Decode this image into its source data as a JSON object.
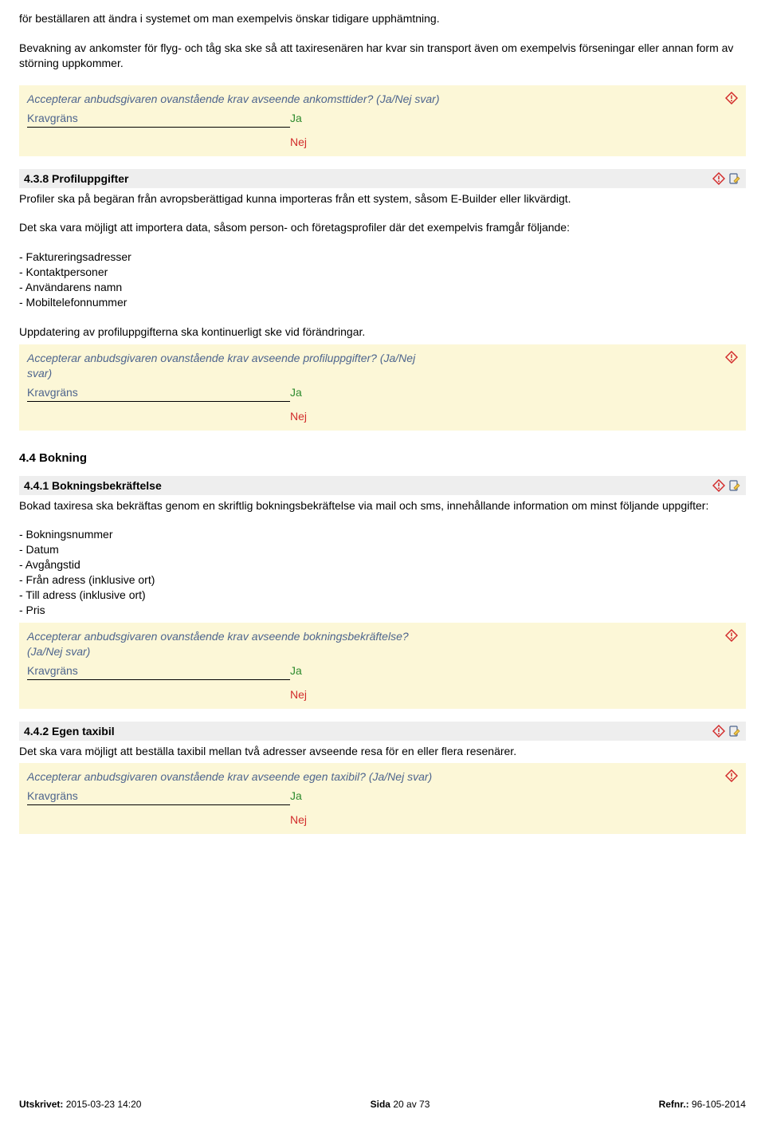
{
  "intro": {
    "p1": "för beställaren att ändra i systemet om man exempelvis önskar tidigare upphämtning.",
    "p2": "Bevakning av ankomster för flyg- och tåg ska ske så att taxiresenären har kvar sin transport även om exempelvis förseningar eller annan form av störning uppkommer."
  },
  "q1": {
    "text": "Accepterar anbudsgivaren ovanstående krav avseende ankomsttider? (Ja/Nej svar)",
    "krav": "Kravgräns",
    "ja": "Ja",
    "nej": "Nej"
  },
  "s438": {
    "heading": "4.3.8 Profiluppgifter",
    "p1": "Profiler ska på begäran från avropsberättigad kunna importeras från ett system, såsom E-Builder eller likvärdigt.",
    "p2": "Det ska vara möjligt att importera data, såsom person- och företagsprofiler där det exempelvis framgår följande:",
    "bullets": [
      "- Faktureringsadresser",
      "- Kontaktpersoner",
      "- Användarens namn",
      "- Mobiltelefonnummer"
    ],
    "p3": "Uppdatering av profiluppgifterna ska kontinuerligt ske vid förändringar."
  },
  "q2": {
    "text": "Accepterar anbudsgivaren ovanstående krav avseende profiluppgifter? (Ja/Nej svar)",
    "krav": "Kravgräns",
    "ja": "Ja",
    "nej": "Nej"
  },
  "s44": {
    "heading": "4.4 Bokning"
  },
  "s441": {
    "heading": "4.4.1 Bokningsbekräftelse",
    "p1": "Bokad taxiresa ska bekräftas genom en skriftlig bokningsbekräftelse via mail och sms, innehållande information om minst följande uppgifter:",
    "bullets": [
      "- Bokningsnummer",
      "- Datum",
      "- Avgångstid",
      "- Från adress (inklusive ort)",
      "- Till adress (inklusive ort)",
      "- Pris"
    ]
  },
  "q3": {
    "text": "Accepterar anbudsgivaren ovanstående krav avseende bokningsbekräftelse? (Ja/Nej svar)",
    "krav": "Kravgräns",
    "ja": "Ja",
    "nej": "Nej"
  },
  "s442": {
    "heading": "4.4.2 Egen taxibil",
    "p1": "Det ska vara möjligt att beställa taxibil mellan två adresser avseende resa för en eller flera resenärer."
  },
  "q4": {
    "text": "Accepterar anbudsgivaren ovanstående krav avseende egen taxibil? (Ja/Nej svar)",
    "krav": "Kravgräns",
    "ja": "Ja",
    "nej": "Nej"
  },
  "footer": {
    "printed_label": "Utskrivet:",
    "printed_value": " 2015-03-23 14:20",
    "page_label": "Sida ",
    "page_cur": "20",
    "page_of": " av ",
    "page_total": "73",
    "ref_label": "Refnr.:",
    "ref_value": " 96-105-2014"
  }
}
